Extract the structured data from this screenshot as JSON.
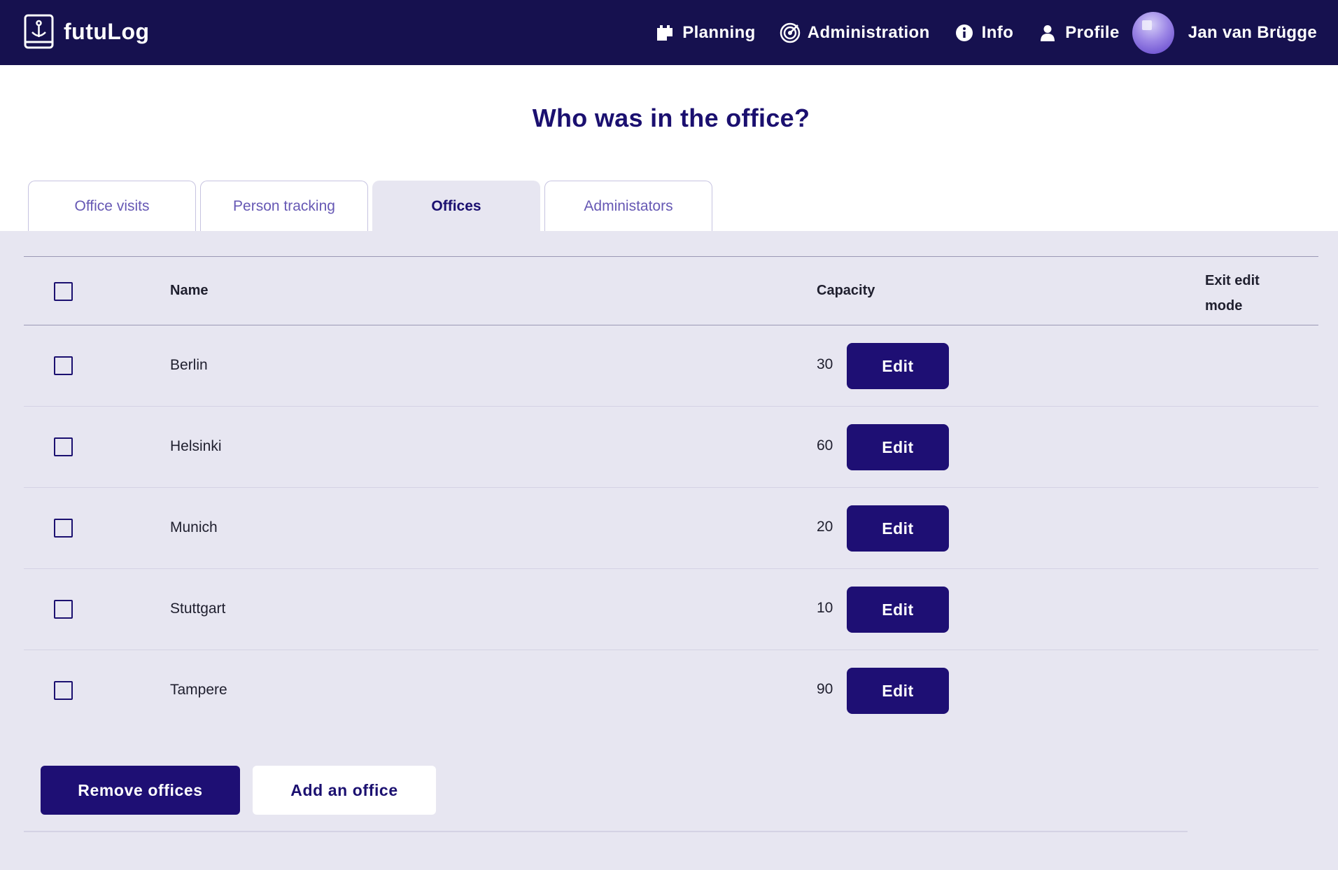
{
  "app": {
    "name": "futuLog"
  },
  "nav": {
    "items": [
      {
        "label": "Planning",
        "icon": "calendar-icon"
      },
      {
        "label": "Administration",
        "icon": "target-icon"
      },
      {
        "label": "Info",
        "icon": "info-icon"
      },
      {
        "label": "Profile",
        "icon": "person-icon"
      }
    ],
    "user_name": "Jan van Brügge"
  },
  "page": {
    "title": "Who was in the office?"
  },
  "tabs": [
    {
      "label": "Office visits",
      "active": false
    },
    {
      "label": "Person tracking",
      "active": false
    },
    {
      "label": "Offices",
      "active": true
    },
    {
      "label": "Administators",
      "active": false
    }
  ],
  "table": {
    "columns": {
      "name": "Name",
      "capacity": "Capacity",
      "exit_edit": "Exit edit mode"
    },
    "rows": [
      {
        "name": "Berlin",
        "capacity": "30",
        "action": "Edit"
      },
      {
        "name": "Helsinki",
        "capacity": "60",
        "action": "Edit"
      },
      {
        "name": "Munich",
        "capacity": "20",
        "action": "Edit"
      },
      {
        "name": "Stuttgart",
        "capacity": "10",
        "action": "Edit"
      },
      {
        "name": "Tampere",
        "capacity": "90",
        "action": "Edit"
      }
    ]
  },
  "actions": {
    "remove": "Remove offices",
    "add": "Add an office"
  },
  "colors": {
    "topbar": "#16114f",
    "primary": "#1e0f74",
    "panel": "#e7e6f1",
    "title": "#1b1070"
  }
}
